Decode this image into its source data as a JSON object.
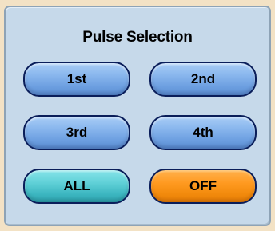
{
  "panel": {
    "title": "Pulse Selection"
  },
  "buttons": {
    "first": "1st",
    "second": "2nd",
    "third": "3rd",
    "fourth": "4th",
    "all": "ALL",
    "off": "OFF"
  },
  "colors": {
    "background": "#f3e2c5",
    "panel": "#c6d9ea",
    "button_blue": "#7aaae6",
    "button_teal": "#4cc3cb",
    "button_orange": "#ff9a20",
    "button_border": "#0a1e5a"
  }
}
